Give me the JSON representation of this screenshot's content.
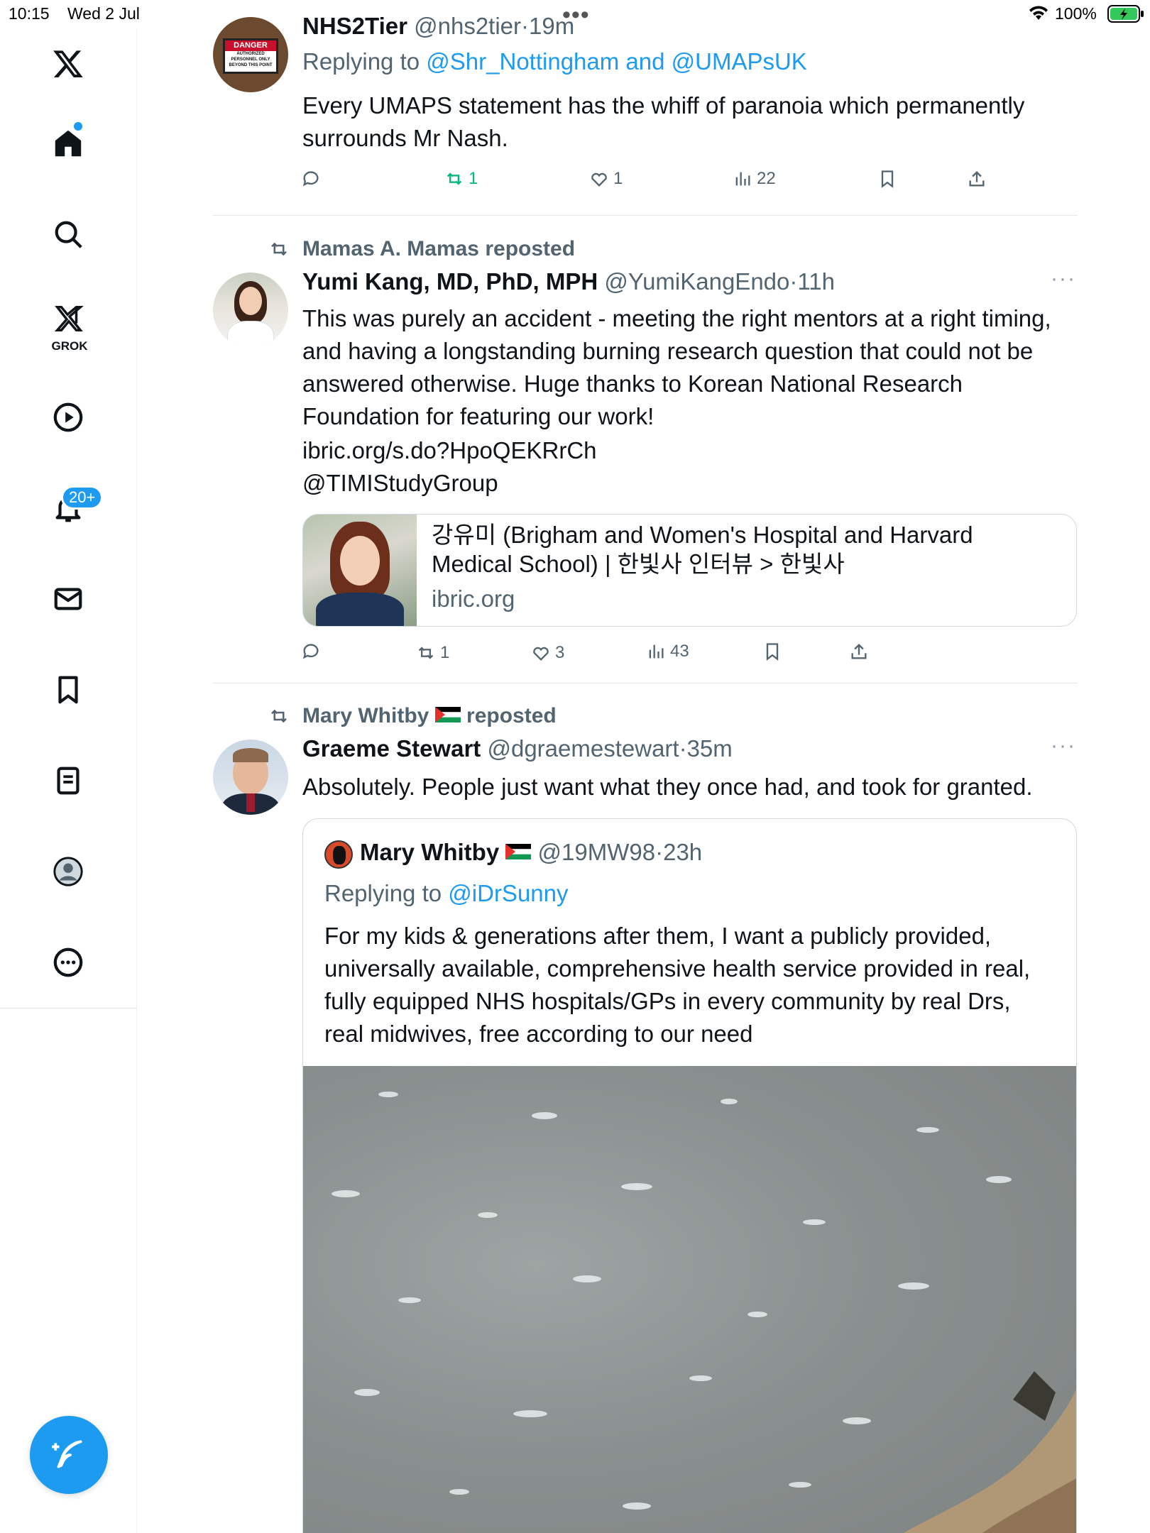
{
  "status_bar": {
    "time": "10:15",
    "date": "Wed 2 Jul",
    "battery": "100%"
  },
  "sidebar": {
    "grok_label": "GROK",
    "notifications_badge": "20+"
  },
  "tweets": [
    {
      "name": "NHS2Tier",
      "handle": "@nhs2tier",
      "time": "19m",
      "replying_prefix": "Replying to",
      "replying_to": "@Shr_Nottingham and @UMAPsUK",
      "text": "Every UMAPS statement has the whiff of paranoia which permanently surrounds Mr Nash.",
      "reposts": "1",
      "likes": "1",
      "views": "22",
      "avatar_sign_title": "DANGER",
      "avatar_sign_text": "AUTHORIZED PERSONNEL ONLY BEYOND THIS POINT"
    },
    {
      "reposted_by": "Mamas A. Mamas reposted",
      "name": "Yumi Kang, MD, PhD, MPH",
      "handle": "@YumiKangEndo",
      "time": "11h",
      "text": "This was purely an accident - meeting the right mentors at a right timing, and having a longstanding burning research question that could not be answered otherwise. Huge thanks to Korean National Research Foundation for featuring our work!",
      "link1": "ibric.org/s.do?HpoQEKRrCh",
      "link2": "@TIMIStudyGroup",
      "card_title": "강유미 (Brigham and Women's Hospital and Harvard Medical School) | 한빛사 인터뷰 > 한빛사",
      "card_domain": "ibric.org",
      "reposts": "1",
      "likes": "3",
      "views": "43"
    },
    {
      "reposted_by_name": "Mary Whitby",
      "reposted_suffix": "reposted",
      "name": "Graeme Stewart",
      "handle": "@dgraemestewart",
      "time": "35m",
      "text": "Absolutely. People just want what they once had, and took for granted.",
      "quote": {
        "name": "Mary Whitby",
        "handle": "@19MW98",
        "time": "23h",
        "replying_prefix": "Replying to",
        "replying_to": "@iDrSunny",
        "text": "For my kids & generations after them, I want a publicly provided, universally available,  comprehensive health service provided in real, fully equipped NHS hospitals/GPs in every community by real Drs, real midwives, free according to our need"
      }
    }
  ],
  "colors": {
    "accent": "#1d9bf0",
    "repost_green": "#00ba7c",
    "muted": "#536471"
  }
}
